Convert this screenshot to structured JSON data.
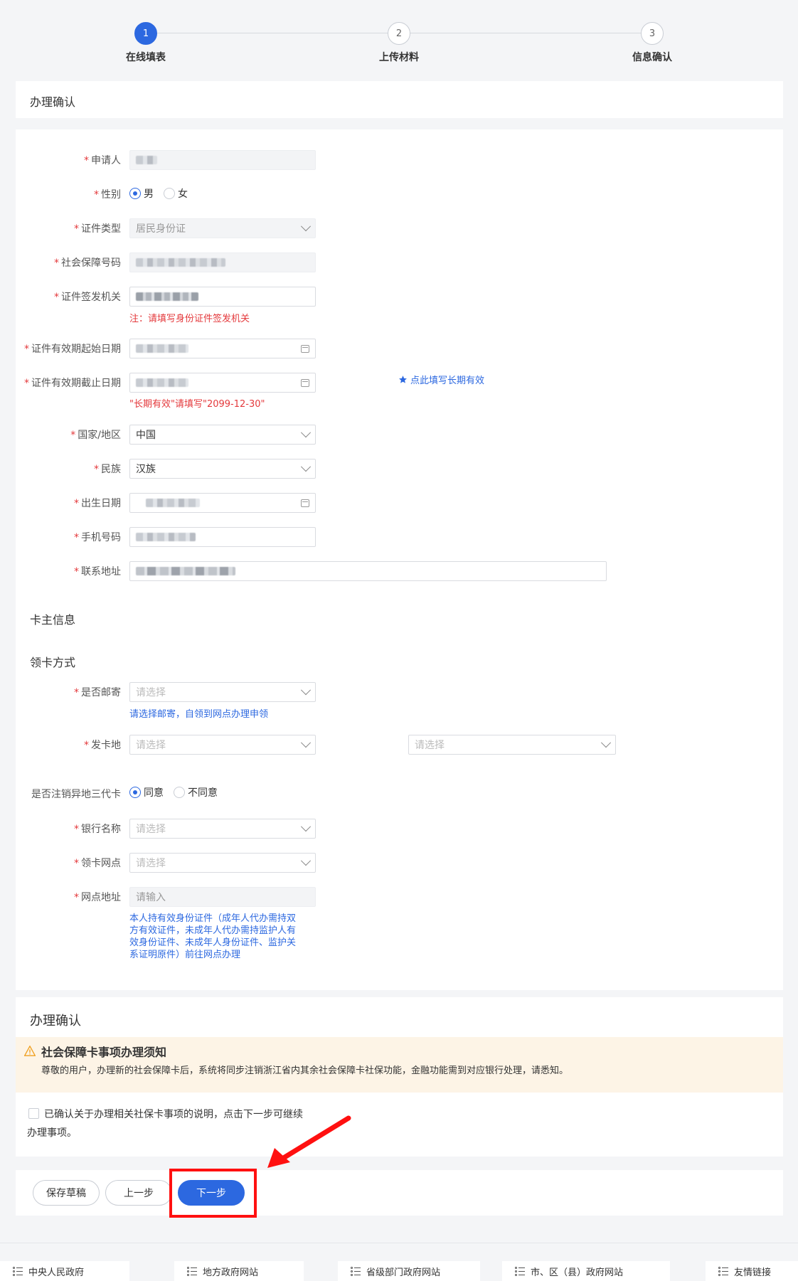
{
  "stepper": {
    "steps": [
      {
        "number": "1",
        "label": "在线填表"
      },
      {
        "number": "2",
        "label": "上传材料"
      },
      {
        "number": "3",
        "label": "信息确认"
      }
    ]
  },
  "header_card": {
    "title": "办理确认"
  },
  "form": {
    "applicant": {
      "label": "申请人"
    },
    "gender": {
      "label": "性别",
      "options": [
        "男",
        "女"
      ],
      "selected": "男"
    },
    "id_type": {
      "label": "证件类型",
      "value": "居民身份证"
    },
    "ss_number": {
      "label": "社会保障号码"
    },
    "issuing_authority": {
      "label": "证件签发机关",
      "note": "注：请填写身份证件签发机关"
    },
    "valid_start": {
      "label": "证件有效期起始日期"
    },
    "valid_end": {
      "label": "证件有效期截止日期",
      "note": "\"长期有效\"请填写\"2099-12-30\"",
      "long_term_link": "点此填写长期有效"
    },
    "country": {
      "label": "国家/地区",
      "value": "中国"
    },
    "ethnicity": {
      "label": "民族",
      "value": "汉族"
    },
    "birth_date": {
      "label": "出生日期"
    },
    "phone": {
      "label": "手机号码"
    },
    "address": {
      "label": "联系地址"
    }
  },
  "cardholder_section": {
    "title": "卡主信息"
  },
  "card_method_section": {
    "title": "领卡方式"
  },
  "card_form": {
    "mail": {
      "label": "是否邮寄",
      "placeholder": "请选择",
      "note": "请选择邮寄，自领到网点办理申领"
    },
    "issue_place": {
      "label": "发卡地",
      "placeholder": "请选择",
      "placeholder2": "请选择"
    },
    "cancel_third_gen": {
      "label": "是否注销异地三代卡",
      "options": [
        "同意",
        "不同意"
      ],
      "selected": "同意"
    },
    "bank": {
      "label": "银行名称",
      "placeholder": "请选择"
    },
    "outlet": {
      "label": "领卡网点",
      "placeholder": "请选择"
    },
    "outlet_address": {
      "label": "网点地址",
      "placeholder": "请输入",
      "note_lines": [
        "本人持有效身份证件（成年人代办需持双",
        "方有效证件，未成年人代办需持监护人有",
        "效身份证件、未成年人身份证件、监护关",
        "系证明原件）前往网点办理"
      ]
    }
  },
  "confirm_section": {
    "title": "办理确认",
    "notice_title": "社会保障卡事项办理须知",
    "notice_body": "尊敬的用户，办理新的社会保障卡后，系统将同步注销浙江省内其余社会保障卡社保功能，金融功能需到对应银行处理，请悉知。",
    "checkbox_line1": "已确认关于办理相关社保卡事项的说明，点击下一步可继续",
    "checkbox_line2": "办理事项。"
  },
  "actions": {
    "save_draft": "保存草稿",
    "prev": "上一步",
    "next": "下一步"
  },
  "footer": {
    "links": [
      "中央人民政府",
      "地方政府网站",
      "省级部门政府网站",
      "市、区（县）政府网站",
      "友情链接"
    ]
  },
  "colors": {
    "primary": "#2c68e0",
    "required": "#e4393c",
    "notice_bg": "#fdf4e6",
    "highlight": "#ff1010"
  }
}
